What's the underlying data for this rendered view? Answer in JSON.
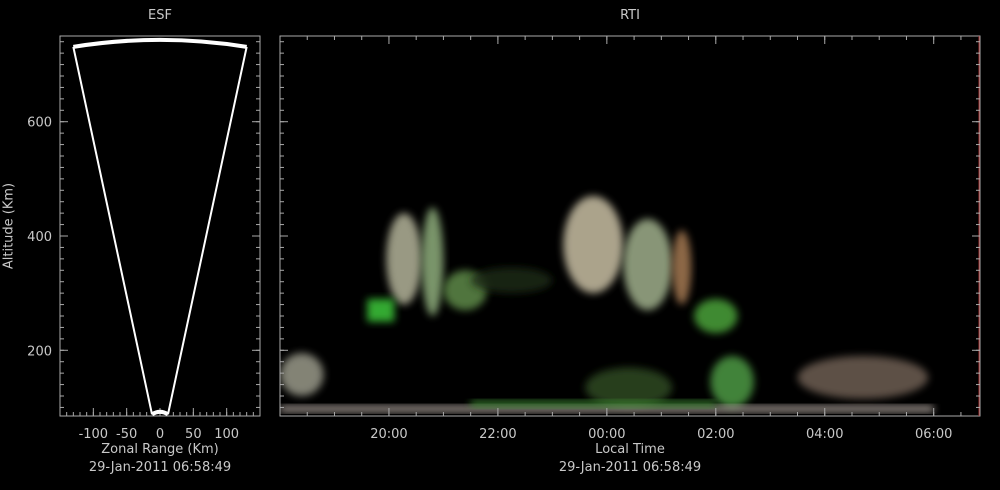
{
  "chart_data": [
    {
      "type": "fan",
      "title": "ESF",
      "xlabel": "Zonal Range (Km)",
      "ylabel": "Altitude (Km)",
      "timestamp": "29-Jan-2011 06:58:49",
      "xlim": [
        -150,
        150
      ],
      "ylim": [
        85,
        750
      ],
      "xticks": [
        -100,
        -50,
        0,
        50,
        100
      ],
      "yticks": [
        200,
        400,
        600
      ],
      "fan": {
        "top_altitude": 745,
        "bottom_altitude": 88,
        "top_half_width": 130,
        "bottom_half_width": 12
      }
    },
    {
      "type": "heatmap",
      "title": "RTI",
      "xlabel": "Local Time",
      "timestamp": "29-Jan-2011 06:58:49",
      "xlim": [
        18.0,
        30.85
      ],
      "ylim": [
        85,
        750
      ],
      "xticks": [
        "20:00",
        "22:00",
        "00:00",
        "02:00",
        "04:00",
        "06:00"
      ],
      "xtick_values": [
        20,
        22,
        24,
        26,
        28,
        30
      ],
      "yticks": [
        200,
        400,
        600
      ],
      "echo_regions": [
        {
          "t_start": 19.95,
          "t_end": 20.6,
          "alt_bottom": 280,
          "alt_top": 440,
          "color": "#b4b49a"
        },
        {
          "t_start": 20.6,
          "t_end": 21.0,
          "alt_bottom": 260,
          "alt_top": 450,
          "color": "#8fae7d"
        },
        {
          "t_start": 21.0,
          "t_end": 21.8,
          "alt_bottom": 270,
          "alt_top": 340,
          "color": "#5f8a4a"
        },
        {
          "t_start": 19.6,
          "t_end": 20.1,
          "alt_bottom": 250,
          "alt_top": 290,
          "color": "#3ec83a"
        },
        {
          "t_start": 21.5,
          "t_end": 23.0,
          "alt_bottom": 300,
          "alt_top": 345,
          "color": "#1a2a12"
        },
        {
          "t_start": 23.2,
          "t_end": 24.3,
          "alt_bottom": 300,
          "alt_top": 470,
          "color": "#c9c0a4"
        },
        {
          "t_start": 24.3,
          "t_end": 25.2,
          "alt_bottom": 270,
          "alt_top": 430,
          "color": "#a0b08c"
        },
        {
          "t_start": 25.2,
          "t_end": 25.55,
          "alt_bottom": 280,
          "alt_top": 410,
          "color": "#a67a52"
        },
        {
          "t_start": 25.6,
          "t_end": 26.4,
          "alt_bottom": 230,
          "alt_top": 290,
          "color": "#4ca33a"
        },
        {
          "t_start": 18.0,
          "t_end": 18.8,
          "alt_bottom": 120,
          "alt_top": 195,
          "color": "#9a9a8a"
        },
        {
          "t_start": 27.5,
          "t_end": 29.9,
          "alt_bottom": 115,
          "alt_top": 190,
          "color": "#6e5e52"
        },
        {
          "t_start": 25.9,
          "t_end": 26.7,
          "alt_bottom": 100,
          "alt_top": 190,
          "color": "#4e9a44"
        },
        {
          "t_start": 23.6,
          "t_end": 25.2,
          "alt_bottom": 100,
          "alt_top": 170,
          "color": "#2e4a24"
        },
        {
          "t_start": 18.0,
          "t_end": 30.0,
          "alt_bottom": 92,
          "alt_top": 103,
          "color": "#c4b8b0"
        },
        {
          "t_start": 21.5,
          "t_end": 26.0,
          "alt_bottom": 100,
          "alt_top": 112,
          "color": "#3d8a32"
        }
      ]
    }
  ]
}
